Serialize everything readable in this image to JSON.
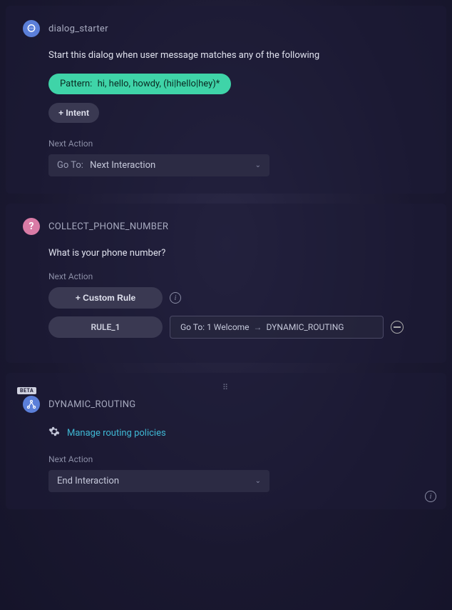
{
  "nodes": {
    "dialog_starter": {
      "title": "dialog_starter",
      "description": "Start this dialog when user message matches any of the following",
      "pattern_label": "Pattern:",
      "pattern_value": "hi, hello, howdy, (hi|hello|hey)*",
      "add_intent_label": "+ Intent",
      "next_action_label": "Next Action",
      "goto_label": "Go To:",
      "goto_value": "Next Interaction"
    },
    "collect_phone": {
      "title": "COLLECT_PHONE_NUMBER",
      "prompt": "What is your phone number?",
      "next_action_label": "Next Action",
      "custom_rule_label": "+ Custom Rule",
      "rule_name": "RULE_1",
      "rule_goto_prefix": "Go To: 1 Welcome",
      "rule_goto_target": "DYNAMIC_ROUTING"
    },
    "dynamic_routing": {
      "beta": "BETA",
      "title": "DYNAMIC_ROUTING",
      "manage_link": "Manage routing policies",
      "next_action_label": "Next Action",
      "action_value": "End Interaction"
    }
  }
}
